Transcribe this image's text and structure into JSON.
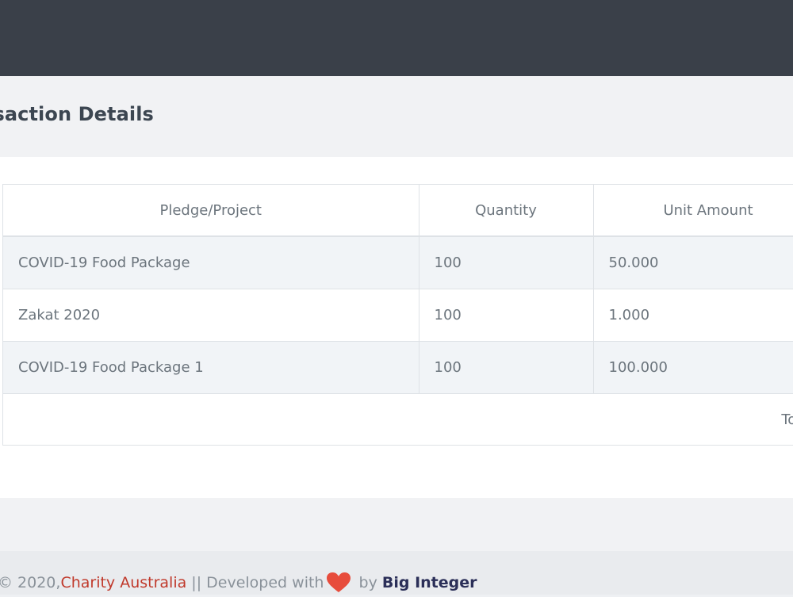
{
  "page": {
    "title": "ansaction Details"
  },
  "table": {
    "headers": [
      "Pledge/Project",
      "Quantity",
      "Unit Amount"
    ],
    "rows": [
      {
        "project": "COVID-19 Food Package",
        "quantity": "100",
        "unit_amount": "50.000"
      },
      {
        "project": "Zakat 2020",
        "quantity": "100",
        "unit_amount": "1.000"
      },
      {
        "project": "COVID-19 Food Package 1",
        "quantity": "100",
        "unit_amount": "100.000"
      }
    ],
    "total_label": "Total Donatio"
  },
  "footer": {
    "copyright": "© 2020, ",
    "org": "Charity Australia",
    "developed_with": " || Developed with",
    "by": " by ",
    "developer": "Big Integer",
    "heart_icon": "heart-icon",
    "heart_color": "#e74c3c"
  },
  "colors": {
    "topbar": "#3a4049",
    "stripe": "#f1f4f7",
    "accent": "#c0392b"
  }
}
